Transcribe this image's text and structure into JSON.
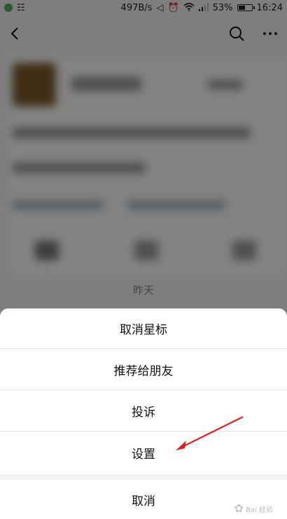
{
  "status_bar": {
    "speed": "497B/s",
    "battery_percent": "53%",
    "time": "16:24",
    "battery_level": 0.53,
    "icons": [
      "app-icon",
      "mute-icon",
      "alarm-icon",
      "wifi-icon",
      "signal-icon",
      "battery-icon"
    ]
  },
  "nav": {
    "icons": [
      "back-icon",
      "search-icon",
      "more-icon"
    ]
  },
  "feed": {
    "date_label": "昨天"
  },
  "action_sheet": {
    "items": [
      {
        "label": "取消星标"
      },
      {
        "label": "推荐给朋友"
      },
      {
        "label": "投诉"
      },
      {
        "label": "设置"
      }
    ],
    "cancel_label": "取消"
  },
  "annotation": {
    "arrow_color": "#e02020",
    "target": "设置"
  },
  "colors": {
    "overlay": "rgba(0,0,0,0.48)",
    "sheet_bg": "#ffffff",
    "divider": "#e5e5e5"
  }
}
